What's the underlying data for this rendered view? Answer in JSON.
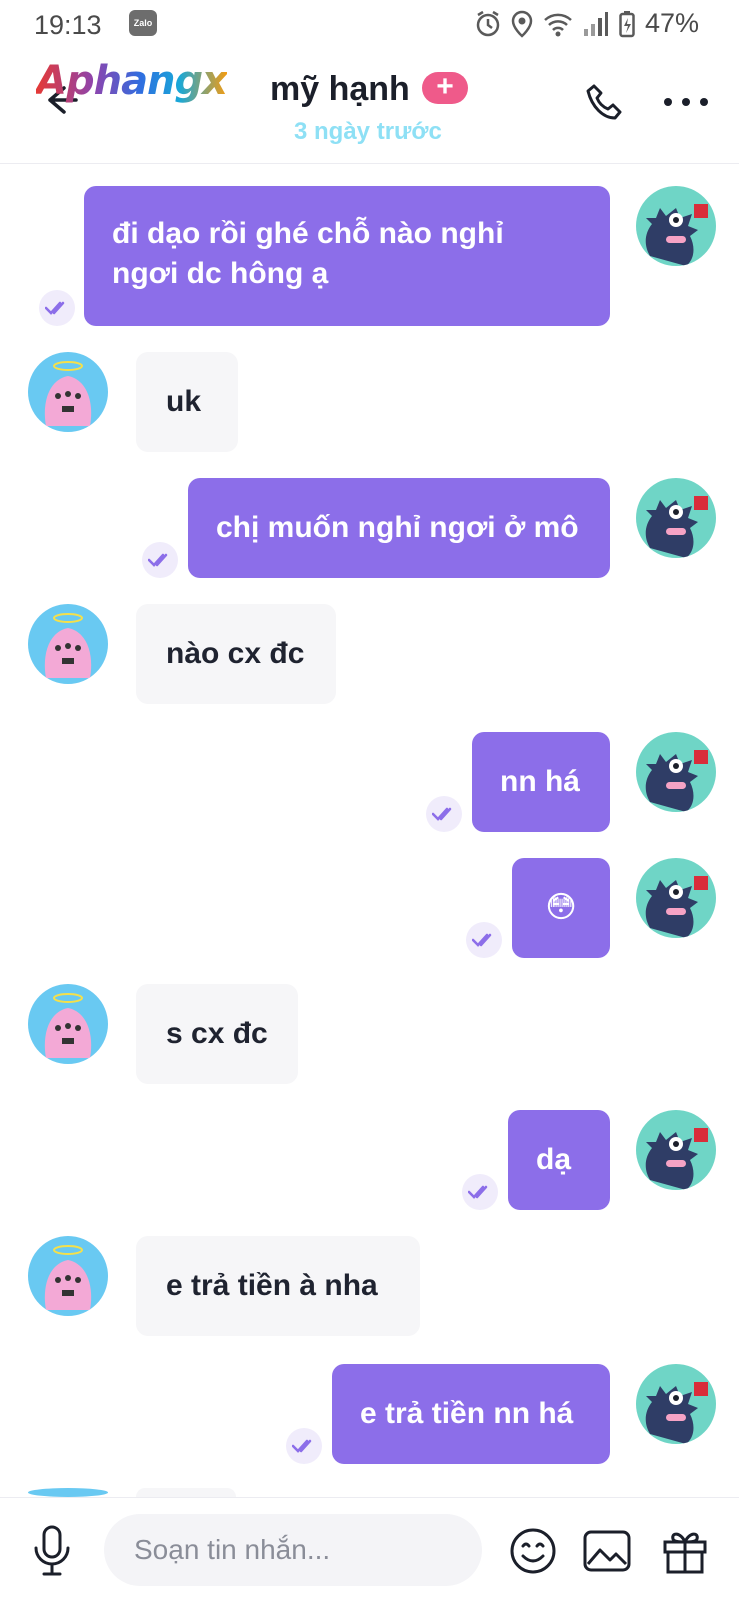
{
  "status_bar": {
    "time": "19:13",
    "notif_app": "Zalo",
    "battery": "47%"
  },
  "header": {
    "brand": "Aphangx",
    "title": "mỹ hạnh",
    "plus": "+",
    "subtitle": "3 ngày trước"
  },
  "messages": [
    {
      "from": "me",
      "lines": [
        "đi dạo rồi ghé chỗ nào nghỉ",
        "ngơi dc hông ạ"
      ]
    },
    {
      "from": "them",
      "lines": [
        "uk"
      ]
    },
    {
      "from": "me",
      "lines": [
        "chị muốn nghỉ ngơi ở mô"
      ]
    },
    {
      "from": "them",
      "lines": [
        "nào cx đc"
      ]
    },
    {
      "from": "me",
      "lines": [
        "nn há"
      ]
    },
    {
      "from": "me",
      "lines": [
        "😳"
      ]
    },
    {
      "from": "them",
      "lines": [
        "s cx đc"
      ]
    },
    {
      "from": "me",
      "lines": [
        "dạ"
      ]
    },
    {
      "from": "them",
      "lines": [
        "e trả tiền à nha"
      ]
    },
    {
      "from": "me",
      "lines": [
        "e trả tiền nn há"
      ]
    }
  ],
  "input": {
    "placeholder": "Soạn tin nhắn..."
  },
  "colors": {
    "sent_bubble": "#8c6ee9",
    "recv_bubble": "#f6f6f8",
    "accent": "#ef5a8a"
  }
}
